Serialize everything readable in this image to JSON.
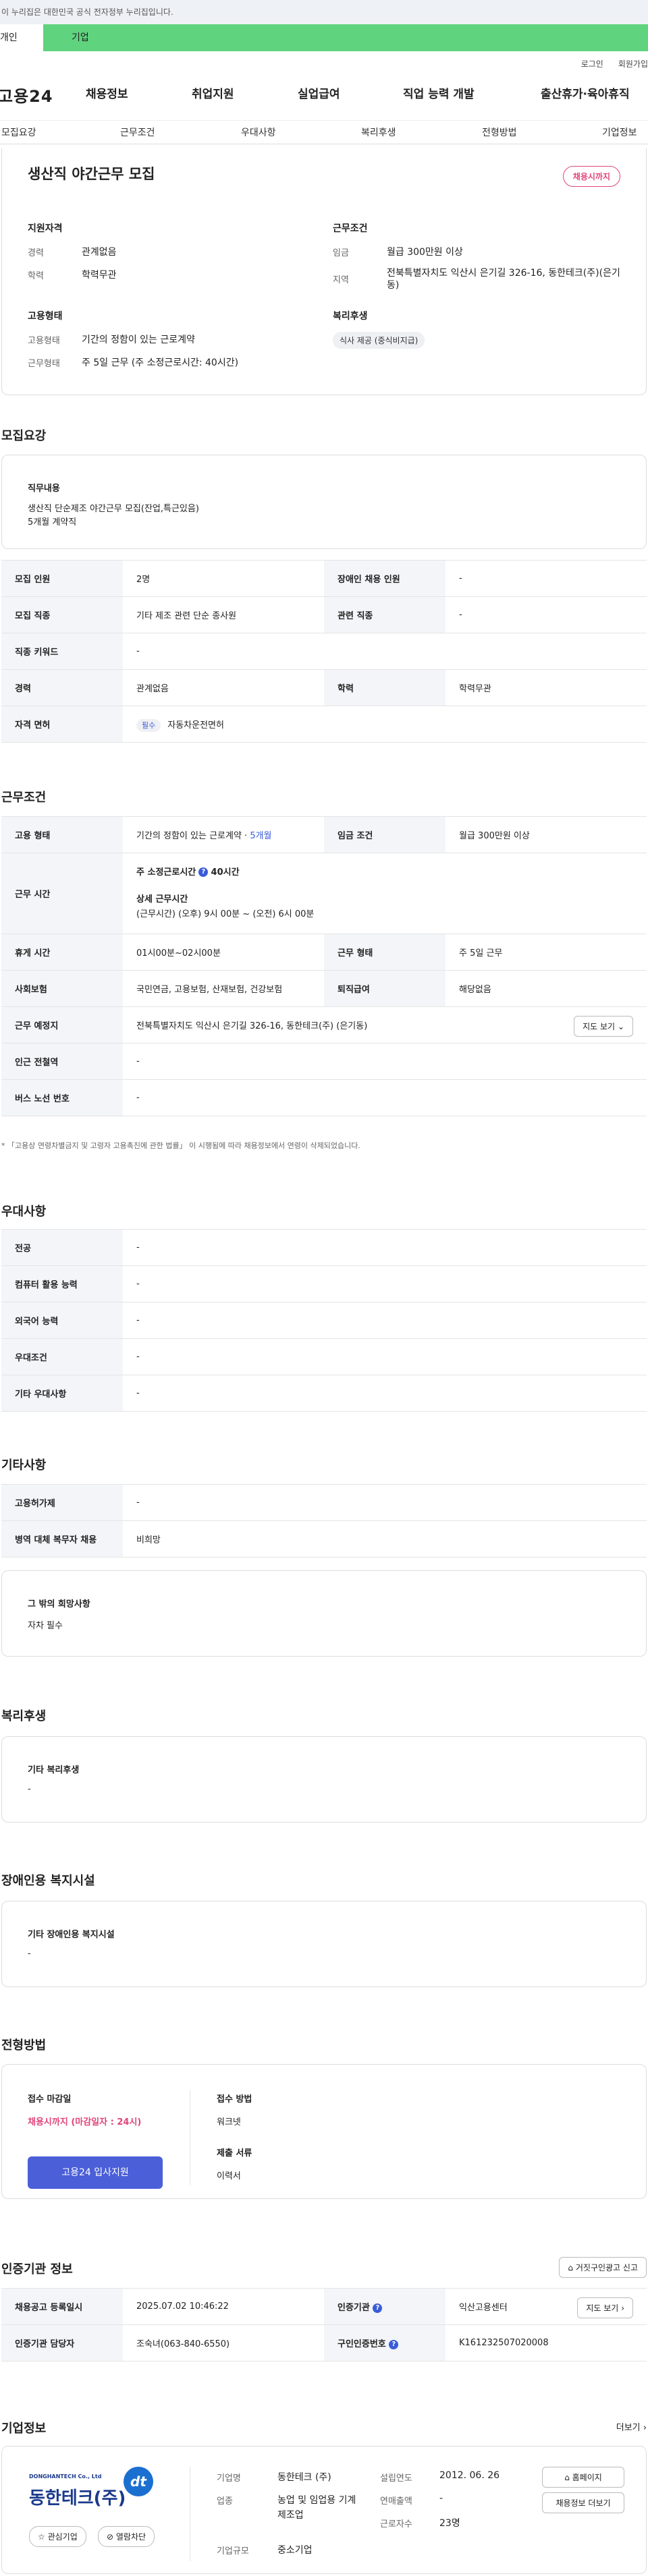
{
  "gov_banner": "이 누리집은 대한민국 공식 전자정부 누리집입니다.",
  "tabs": {
    "person": "개인",
    "company": "기업"
  },
  "util": {
    "login": "로그인",
    "signup": "회원가입"
  },
  "gnb": {
    "logo": "고용24",
    "menu": [
      "채용정보",
      "취업지원",
      "실업급여",
      "직업 능력 개발",
      "출산휴가·육아휴직"
    ]
  },
  "sub_nav": [
    "모집요강",
    "근무조건",
    "우대사항",
    "복리후생",
    "전형방법",
    "기업정보"
  ],
  "job": {
    "title": "생산직 야간근무 모집",
    "status_badge": "채용시까지"
  },
  "summary": {
    "qual_title": "지원자격",
    "qual": [
      {
        "k": "경력",
        "v": "관계없음"
      },
      {
        "k": "학력",
        "v": "학력무관"
      }
    ],
    "cond_title": "근무조건",
    "cond": [
      {
        "k": "임금",
        "v": "월급 300만원 이상"
      },
      {
        "k": "지역",
        "v": "전북특별자치도 익산시 은기길 326-16, 동한테크(주)(은기동)"
      }
    ],
    "type_title": "고용형태",
    "type": [
      {
        "k": "고용형태",
        "v": "기간의 정함이 있는 근로계약"
      },
      {
        "k": "근무형태",
        "v": "주 5일 근무 (주 소정근로시간: 40시간)"
      }
    ],
    "welfare_title": "복리후생",
    "welfare_chip": "식사 제공 (중식비지급)"
  },
  "recruit": {
    "section": "모집요강",
    "duty_title": "직무내용",
    "duty_lines": [
      "생산직 단순제조 야간근무 모집(잔업,특근있음)",
      "5개월 계약직"
    ],
    "rows": {
      "headcount_k": "모집 인원",
      "headcount_v": "2명",
      "disabled_k": "장애인 채용 인원",
      "disabled_v": "-",
      "job_k": "모집 직종",
      "job_v": "기타 제조 관련 단순 종사원",
      "related_k": "관련 직종",
      "related_v": "-",
      "keyword_k": "직종 키워드",
      "keyword_v": "-",
      "career_k": "경력",
      "career_v": "관계없음",
      "edu_k": "학력",
      "edu_v": "학력무관",
      "license_k": "자격 면허",
      "license_tag": "필수",
      "license_v": "자동차운전면허"
    }
  },
  "work": {
    "section": "근무조건",
    "type_k": "고용 형태",
    "type_v": "기간의 정함이 있는 근로계약",
    "type_months": "5개월",
    "pay_k": "임금 조건",
    "pay_v": "월급 300만원 이상",
    "hours_k": "근무 시간",
    "hours_line1": "주 소정근로시간",
    "hours_line1_val": "40시간",
    "hours_line2": "상세 근무시간",
    "hours_line3": "(근무시간) (오후) 9시 00분 ~ (오전) 6시 00분",
    "break_k": "휴게 시간",
    "break_v": "01시00분~02시00분",
    "form_k": "근무 형태",
    "form_v": "주 5일 근무",
    "insure_k": "사회보험",
    "insure_v": "국민연금, 고용보험, 산재보험, 건강보험",
    "retire_k": "퇴직급여",
    "retire_v": "해당없음",
    "place_k": "근무 예정지",
    "place_v": "전북특별자치도 익산시 은기길 326-16, 동한테크(주) (은기동)",
    "map_btn": "지도 보기",
    "subway_k": "인근 전철역",
    "subway_v": "-",
    "bus_k": "버스 노선 번호",
    "bus_v": "-",
    "note": "* 「고용상 연령차별금지 및 고령자 고용촉진에 관한 법률」 이 시행됨에 따라 채용정보에서 연령이 삭제되었습니다."
  },
  "pref": {
    "section": "우대사항",
    "rows": [
      [
        "전공",
        "-"
      ],
      [
        "컴퓨터 활용 능력",
        "-"
      ],
      [
        "외국어 능력",
        "-"
      ],
      [
        "우대조건",
        "-"
      ],
      [
        "기타 우대사항",
        "-"
      ]
    ]
  },
  "etc": {
    "section": "기타사항",
    "rows": [
      [
        "고용허가제",
        "-"
      ],
      [
        "병역 대체 복무자 채용",
        "비희망"
      ]
    ],
    "other_title": "그 밖의 희망사항",
    "other_v": "자차 필수"
  },
  "welfare": {
    "section": "복리후생",
    "title": "기타 복리후생",
    "v": "-"
  },
  "disabled": {
    "section": "장애인용 복지시설",
    "title": "기타 장애인용 복지시설",
    "v": "-"
  },
  "process": {
    "section": "전형방법",
    "deadline_k": "접수 마감일",
    "deadline_v": "채용시까지 (마감일자 : 24시)",
    "apply_btn": "고용24 입사지원",
    "method_k": "접수 방법",
    "method_v": "워크넷",
    "docs_k": "제출 서류",
    "docs_v": "이력서"
  },
  "agency": {
    "section": "인증기관 정보",
    "report_btn": "거짓구인광고 신고",
    "reg_k": "채용공고 등록일시",
    "reg_v": "2025.07.02 10:46:22",
    "org_k": "인증기관",
    "org_v": "익산고용센터",
    "map_btn": "지도 보기",
    "contact_k": "인증기관 담당자",
    "contact_v": "조숙녀(063-840-6550)",
    "num_k": "구인인증번호",
    "num_v": "K161232507020008"
  },
  "company": {
    "section": "기업정보",
    "more": "더보기",
    "logo_en": "DONGHANTECH Co., Ltd",
    "logo_ko": "동한테크(주)",
    "logo_mark": "dt",
    "fav_btn": "관심기업",
    "block_btn": "열람차단",
    "home_btn": "홈페이지",
    "list_btn": "채용정보 더보기",
    "name_k": "기업명",
    "name_v": "동한테크 (주)",
    "found_k": "설립연도",
    "found_v": "2012. 06. 26",
    "ind_k": "업종",
    "ind_v": "농업 및 임업용 기계 제조업",
    "sales_k": "연매출액",
    "sales_v": "-",
    "emp_k": "근로자수",
    "emp_v": "23명",
    "size_k": "기업규모",
    "size_v": "중소기업"
  }
}
